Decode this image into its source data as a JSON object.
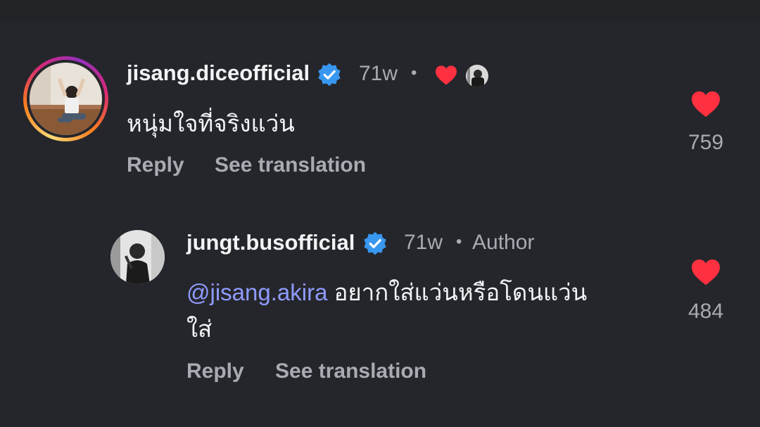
{
  "comments": [
    {
      "username": "jisang.diceofficial",
      "time": "71w",
      "separator": "•",
      "text": "หนุ่มใจที่จริงแว่น",
      "reply_label": "Reply",
      "translate_label": "See translation",
      "like_count": "759",
      "story_ring": true,
      "liked_by_author": true,
      "verified": true
    },
    {
      "username": "jungt.busofficial",
      "time": "71w",
      "separator": "•",
      "author_label": "Author",
      "mention": "@jisang.akira",
      "text_line1": " อยากใส่แว่นหรือโดนแว่น",
      "text_line2": "ใส่",
      "reply_label": "Reply",
      "translate_label": "See translation",
      "like_count": "484",
      "verified": true
    }
  ],
  "colors": {
    "background": "#25262b",
    "verified": "#3897f0",
    "heart": "#ff3040",
    "mention": "#8f9bff",
    "muted_text": "#a8abb2"
  },
  "icons": [
    "verified-badge-icon",
    "heart-icon",
    "author-avatar-mini-icon"
  ]
}
